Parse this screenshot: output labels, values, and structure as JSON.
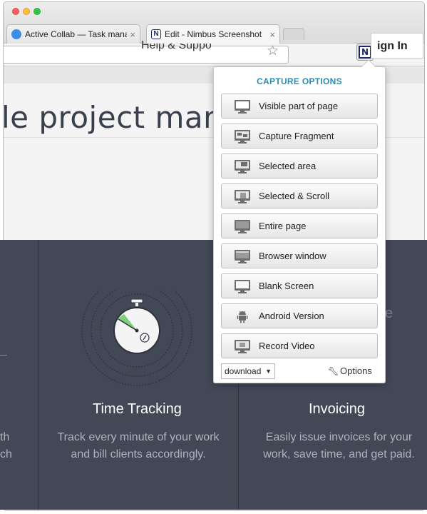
{
  "browser": {
    "tabs": [
      {
        "title": "Active Collab — Task mana",
        "close": "×"
      },
      {
        "title": "Edit - Nimbus Screenshot",
        "close": "×"
      }
    ],
    "nimbus_logo": "N"
  },
  "site": {
    "nav_help": "Help & Suppo",
    "nav_signin": "ign In",
    "hero_title": "le project mana",
    "left_fragment_1": "th",
    "left_fragment_2": "ch",
    "features": [
      {
        "title": "Time Tracking",
        "desc_1": "Track every minute of your work",
        "desc_2": "and bill clients accordingly."
      },
      {
        "title": "Invoicing",
        "desc_1": "Easily issue invoices for your",
        "desc_2": "work, save time, and get paid."
      }
    ],
    "letter_e": "e"
  },
  "popup": {
    "title": "CAPTURE OPTIONS",
    "options": [
      {
        "label": "Visible part of page",
        "icon": "visible-page-icon"
      },
      {
        "label": "Capture Fragment",
        "icon": "fragment-icon"
      },
      {
        "label": "Selected area",
        "icon": "selected-area-icon"
      },
      {
        "label": "Selected & Scroll",
        "icon": "selected-scroll-icon"
      },
      {
        "label": "Entire page",
        "icon": "entire-page-icon"
      },
      {
        "label": "Browser window",
        "icon": "browser-window-icon"
      },
      {
        "label": "Blank Screen",
        "icon": "blank-screen-icon"
      },
      {
        "label": "Android Version",
        "icon": "android-icon"
      },
      {
        "label": "Record Video",
        "icon": "record-video-icon"
      }
    ],
    "download": {
      "value": "download",
      "caret": "▼"
    },
    "options_label": "Options"
  },
  "colors": {
    "accent": "#2b8db4",
    "dark_section": "#434857"
  }
}
